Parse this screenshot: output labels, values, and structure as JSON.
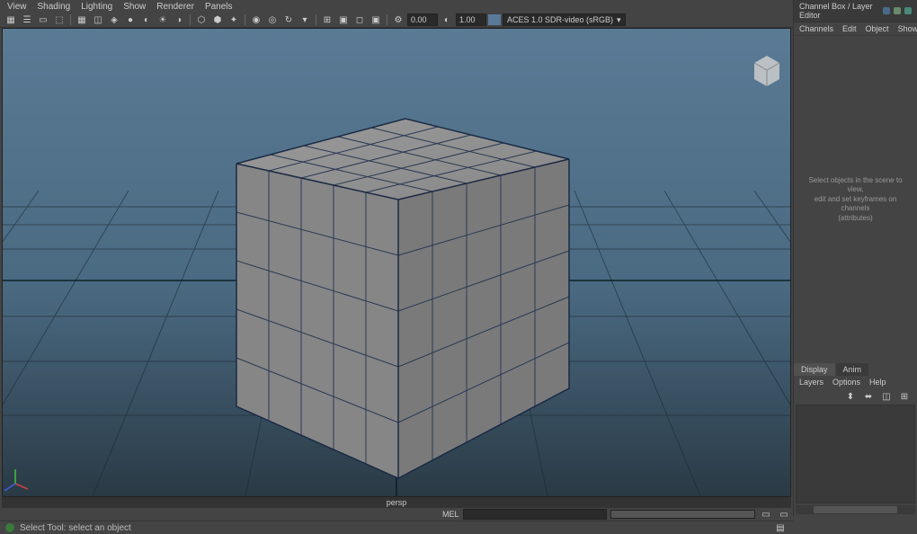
{
  "viewport_menu": {
    "view": "View",
    "shading": "Shading",
    "lighting": "Lighting",
    "show": "Show",
    "renderer": "Renderer",
    "panels": "Panels"
  },
  "toolbar": {
    "num1": "0.00",
    "num2": "1.00",
    "colorspace": "ACES 1.0 SDR-video (sRGB)"
  },
  "viewport": {
    "camera": "persp"
  },
  "channel_box": {
    "title": "Channel Box / Layer Editor",
    "menu": {
      "channels": "Channels",
      "edit": "Edit",
      "object": "Object",
      "show": "Show"
    },
    "hint_l1": "Select objects in the scene to view,",
    "hint_l2": "edit and set keyframes on channels",
    "hint_l3": "(attributes)"
  },
  "layer_editor": {
    "tab_display": "Display",
    "tab_anim": "Anim",
    "menu": {
      "layers": "Layers",
      "options": "Options",
      "help": "Help"
    }
  },
  "status": {
    "tool": "Select Tool: select an object",
    "mel": "MEL"
  }
}
